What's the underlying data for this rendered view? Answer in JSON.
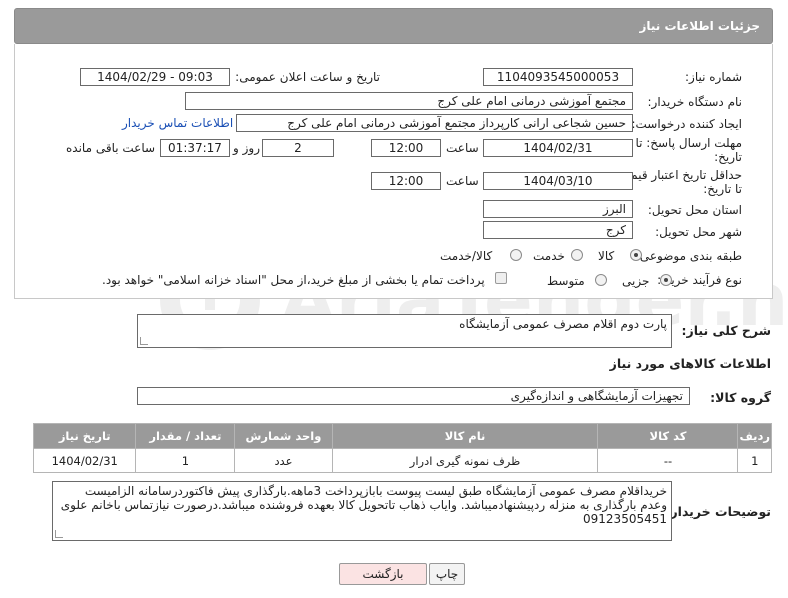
{
  "header": {
    "title": "جزئیات اطلاعات نیاز"
  },
  "fields": {
    "need_number_label": "شماره نیاز:",
    "need_number": "1104093545000053",
    "announce_label": "تاریخ و ساعت اعلان عمومی:",
    "announce_value": "1404/02/29 - 09:03",
    "buyer_org_label": "نام دستگاه خریدار:",
    "buyer_org": "مجتمع آموزشی درمانی امام علی کرج",
    "requester_label": "ایجاد کننده درخواست:",
    "requester": "حسین شجاعی ارانی کارپرداز مجتمع آموزشی درمانی امام علی کرج",
    "contact_link": "اطلاعات تماس خریدار",
    "deadline_label_1": "مهلت ارسال پاسخ: تا",
    "deadline_label_2": "تاریخ:",
    "deadline_date": "1404/02/31",
    "time_label": "ساعت",
    "deadline_time": "12:00",
    "days_value": "2",
    "days_label": "روز و",
    "remaining_time": "01:37:17",
    "remaining_label": "ساعت باقی مانده",
    "validity_label_1": "حداقل تاریخ اعتبار قیمت:",
    "validity_label_2": "تا تاریخ:",
    "validity_date": "1404/03/10",
    "validity_time": "12:00",
    "province_label": "استان محل تحویل:",
    "province": "البرز",
    "city_label": "شهر محل تحویل:",
    "city": "کرج",
    "category_label": "طبقه بندی موضوعی:",
    "category_options": [
      "کالا",
      "خدمت",
      "کالا/خدمت"
    ],
    "purchase_type_label": "نوع فرآیند خرید :",
    "purchase_options": [
      "جزیی",
      "متوسط"
    ],
    "payment_note": "پرداخت تمام یا بخشی از مبلغ خرید،از محل \"اسناد خزانه اسلامی\" خواهد بود."
  },
  "description": {
    "label": "شرح کلی نیاز:",
    "value": "پارت دوم اقلام مصرف عمومی آزمایشگاه"
  },
  "goods_info": {
    "title": "اطلاعات کالاهای مورد نیاز",
    "group_label": "گروه کالا:",
    "group_value": "تجهیزات آزمایشگاهی و اندازه‌گیری"
  },
  "table": {
    "headers": [
      "ردیف",
      "کد کالا",
      "نام کالا",
      "واحد شمارش",
      "تعداد / مقدار",
      "تاریخ نیاز"
    ],
    "rows": [
      [
        "1",
        "--",
        "ظرف نمونه گیری ادرار",
        "عدد",
        "1",
        "1404/02/31"
      ]
    ]
  },
  "buyer_notes": {
    "label": "توضیحات خریدار:",
    "value": "خریداقلام مصرف عمومی آزمایشگاه طبق لیست پیوست بابازپرداخت 3ماهه.بارگذاری پیش فاکتوردرسامانه الزامیست وعدم بارگذاری به منزله ردپیشنهادمیباشد. وایاب ذهاب تاتحویل کالا بعهده فروشنده میباشد.درصورت نیازتماس باخانم علوی 09123505451"
  },
  "buttons": {
    "print": "چاپ",
    "back": "بازگشت"
  },
  "watermark": {
    "text": "AriaTender.net"
  },
  "colors": {
    "header_bg": "#9a9a9a",
    "link": "#1a4fb5",
    "back_btn_bg": "#fbe3e3"
  }
}
